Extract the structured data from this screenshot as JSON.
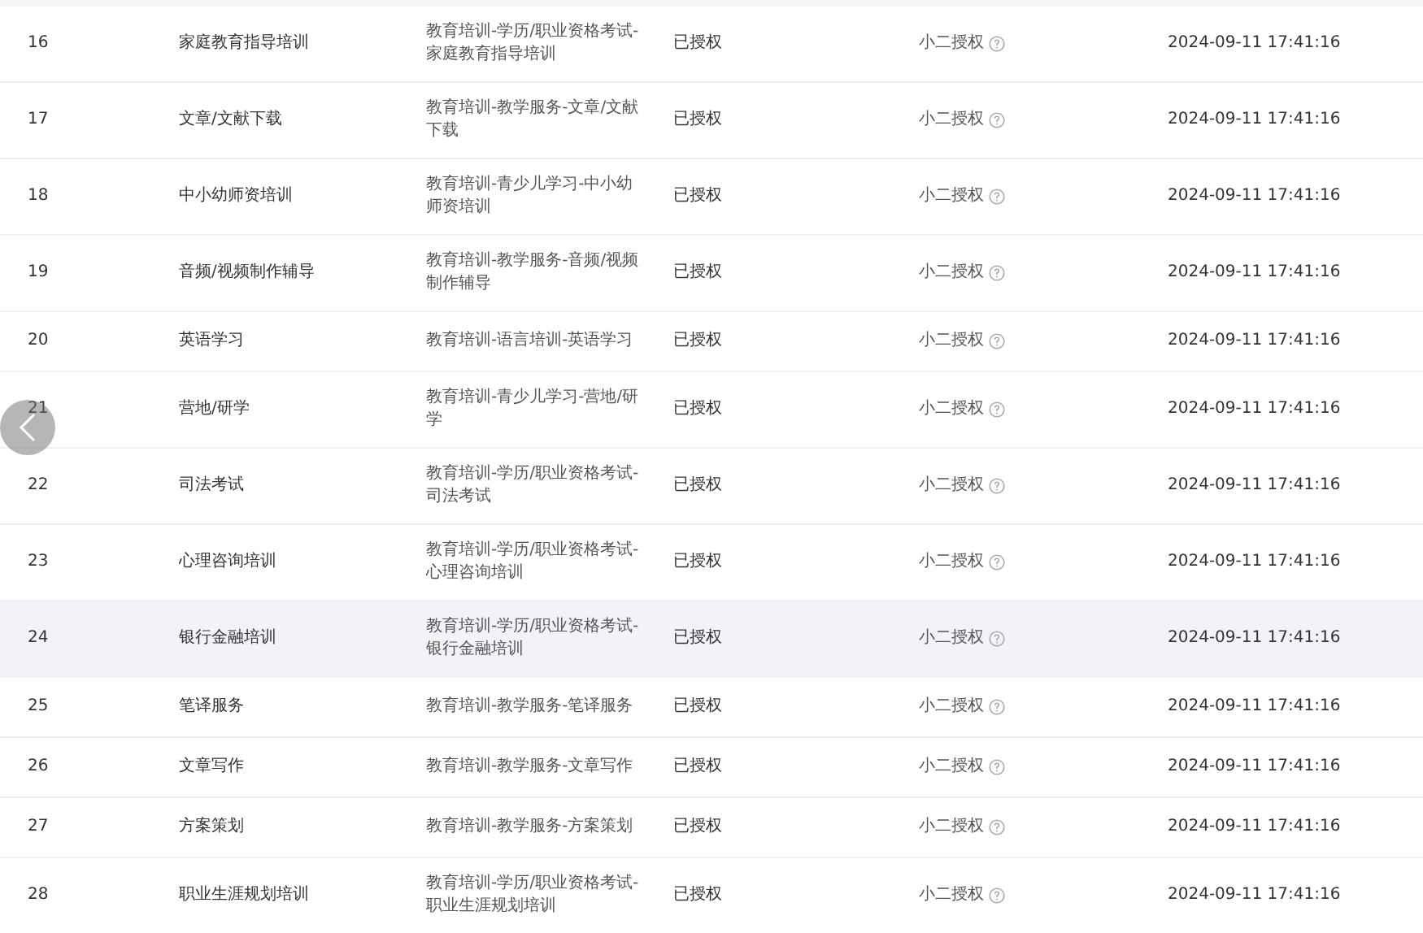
{
  "rows": [
    {
      "index": "16",
      "name": "家庭教育指导培训",
      "category": "教育培训-学历/职业资格考试-家庭教育指导培训",
      "status": "已授权",
      "source": "小二授权",
      "time": "2024-09-11 17:41:16",
      "hovered": false
    },
    {
      "index": "17",
      "name": "文章/文献下载",
      "category": "教育培训-教学服务-文章/文献下载",
      "status": "已授权",
      "source": "小二授权",
      "time": "2024-09-11 17:41:16",
      "hovered": false
    },
    {
      "index": "18",
      "name": "中小幼师资培训",
      "category": "教育培训-青少儿学习-中小幼师资培训",
      "status": "已授权",
      "source": "小二授权",
      "time": "2024-09-11 17:41:16",
      "hovered": false
    },
    {
      "index": "19",
      "name": "音频/视频制作辅导",
      "category": "教育培训-教学服务-音频/视频制作辅导",
      "status": "已授权",
      "source": "小二授权",
      "time": "2024-09-11 17:41:16",
      "hovered": false
    },
    {
      "index": "20",
      "name": "英语学习",
      "category": "教育培训-语言培训-英语学习",
      "status": "已授权",
      "source": "小二授权",
      "time": "2024-09-11 17:41:16",
      "hovered": false
    },
    {
      "index": "21",
      "name": "营地/研学",
      "category": "教育培训-青少儿学习-营地/研学",
      "status": "已授权",
      "source": "小二授权",
      "time": "2024-09-11 17:41:16",
      "hovered": false
    },
    {
      "index": "22",
      "name": "司法考试",
      "category": "教育培训-学历/职业资格考试-司法考试",
      "status": "已授权",
      "source": "小二授权",
      "time": "2024-09-11 17:41:16",
      "hovered": false
    },
    {
      "index": "23",
      "name": "心理咨询培训",
      "category": "教育培训-学历/职业资格考试-心理咨询培训",
      "status": "已授权",
      "source": "小二授权",
      "time": "2024-09-11 17:41:16",
      "hovered": false
    },
    {
      "index": "24",
      "name": "银行金融培训",
      "category": "教育培训-学历/职业资格考试-银行金融培训",
      "status": "已授权",
      "source": "小二授权",
      "time": "2024-09-11 17:41:16",
      "hovered": true
    },
    {
      "index": "25",
      "name": "笔译服务",
      "category": "教育培训-教学服务-笔译服务",
      "status": "已授权",
      "source": "小二授权",
      "time": "2024-09-11 17:41:16",
      "hovered": false
    },
    {
      "index": "26",
      "name": "文章写作",
      "category": "教育培训-教学服务-文章写作",
      "status": "已授权",
      "source": "小二授权",
      "time": "2024-09-11 17:41:16",
      "hovered": false
    },
    {
      "index": "27",
      "name": "方案策划",
      "category": "教育培训-教学服务-方案策划",
      "status": "已授权",
      "source": "小二授权",
      "time": "2024-09-11 17:41:16",
      "hovered": false
    },
    {
      "index": "28",
      "name": "职业生涯规划培训",
      "category": "教育培训-学历/职业资格考试-职业生涯规划培训",
      "status": "已授权",
      "source": "小二授权",
      "time": "2024-09-11 17:41:16",
      "hovered": false
    }
  ]
}
